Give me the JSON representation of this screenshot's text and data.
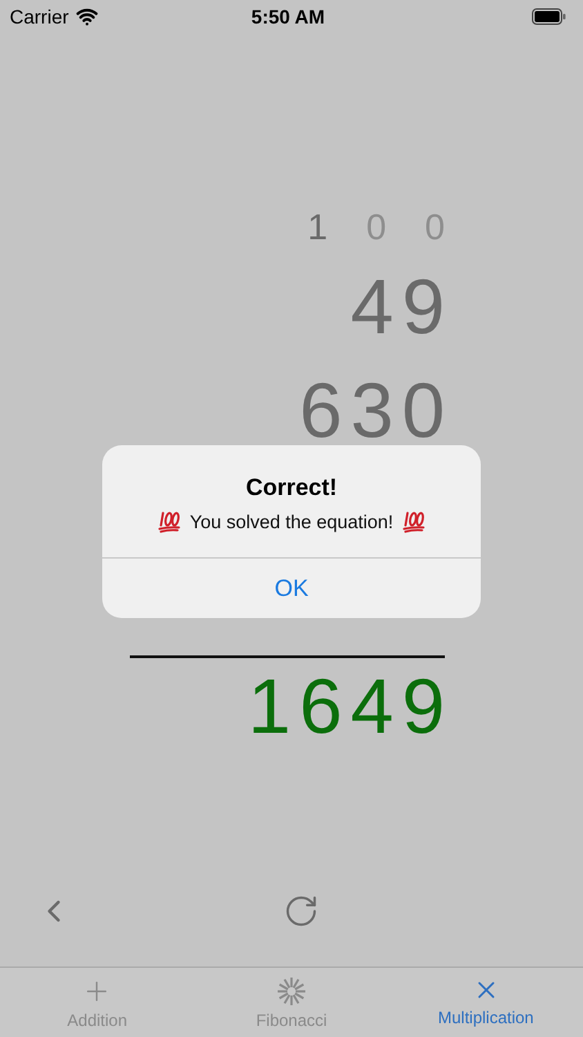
{
  "status_bar": {
    "carrier": "Carrier",
    "time": "5:50 AM"
  },
  "problem": {
    "carries": [
      {
        "digit": "1",
        "faded": false
      },
      {
        "digit": "0",
        "faded": true
      },
      {
        "digit": "0",
        "faded": true
      }
    ],
    "rows": [
      {
        "value": "49"
      },
      {
        "value": "630"
      }
    ],
    "answer": {
      "value": "1649",
      "correct": true
    }
  },
  "alert": {
    "title": "Correct!",
    "message": "You solved the equation!",
    "button": "OK"
  },
  "tabs": [
    {
      "label": "Addition",
      "kind": "plus",
      "selected": false
    },
    {
      "label": "Fibonacci",
      "kind": "burst",
      "selected": false
    },
    {
      "label": "Multiplication",
      "kind": "cross",
      "selected": true
    }
  ]
}
